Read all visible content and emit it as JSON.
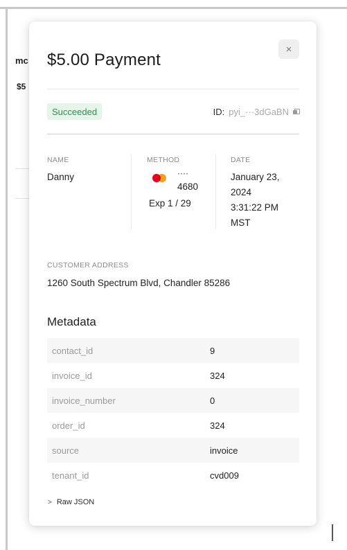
{
  "background": {
    "fragment_1": "mc",
    "fragment_2": "$5"
  },
  "modal": {
    "title": "$5.00 Payment",
    "close_glyph": "×",
    "status": "Succeeded",
    "id_label": "ID:",
    "id_value": "pyi_···3dGaBN",
    "name_label": "NAME",
    "name_value": "Danny",
    "method_label": "METHOD",
    "card_dots": "····",
    "card_last4": "4680",
    "card_exp": "Exp 1 / 29",
    "date_label": "DATE",
    "date_line1": "January 23,",
    "date_line2": "2024",
    "date_line3": "3:31:22 PM",
    "date_line4": "MST",
    "address_label": "CUSTOMER ADDRESS",
    "address_value": "1260 South Spectrum Blvd, Chandler 85286",
    "metadata_title": "Metadata",
    "metadata": [
      {
        "key": "contact_id",
        "value": "9"
      },
      {
        "key": "invoice_id",
        "value": "324"
      },
      {
        "key": "invoice_number",
        "value": "0"
      },
      {
        "key": "order_id",
        "value": "324"
      },
      {
        "key": "source",
        "value": "invoice"
      },
      {
        "key": "tenant_id",
        "value": "cvd009"
      }
    ],
    "raw_json_chevron": ">",
    "raw_json_label": "Raw JSON"
  },
  "colors": {
    "status_bg": "#e6f5ea",
    "status_text": "#2f8f4b",
    "mastercard_red": "#eb001b",
    "mastercard_orange": "#f79e1b"
  },
  "icons": [
    "close-icon",
    "copy-icon",
    "mastercard-icon",
    "chevron-right-icon"
  ]
}
